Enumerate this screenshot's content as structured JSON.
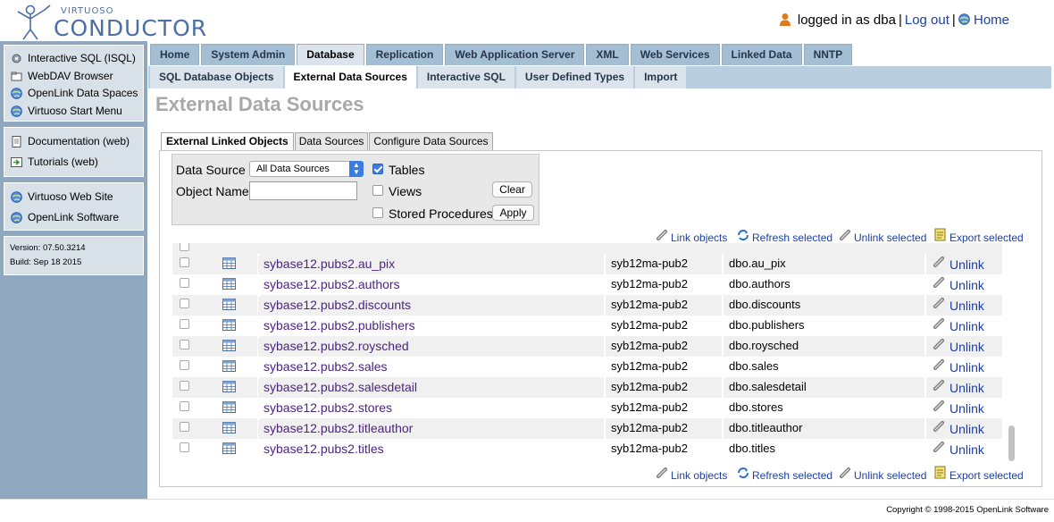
{
  "header": {
    "logo_small": "VIRTUOSO",
    "logo_big": "CONDUCTOR",
    "login_text": "logged in as dba",
    "logout": "Log out",
    "home": "Home"
  },
  "sidebar": {
    "group1": [
      {
        "label": "Interactive SQL (ISQL)",
        "icon": "gear-icon"
      },
      {
        "label": "WebDAV Browser",
        "icon": "folder-icon"
      },
      {
        "label": "OpenLink Data Spaces",
        "icon": "globe-icon"
      },
      {
        "label": "Virtuoso Start Menu",
        "icon": "globe-icon"
      }
    ],
    "group2": [
      {
        "label": "Documentation (web)",
        "icon": "document-icon"
      },
      {
        "label": "Tutorials (web)",
        "icon": "tutorial-icon"
      }
    ],
    "group3": [
      {
        "label": "Virtuoso Web Site",
        "icon": "globe-icon"
      },
      {
        "label": "OpenLink Software",
        "icon": "globe-icon"
      }
    ],
    "version": "Version: 07.50.3214",
    "build": "Build: Sep 18 2015"
  },
  "tabs": [
    "Home",
    "System Admin",
    "Database",
    "Replication",
    "Web Application Server",
    "XML",
    "Web Services",
    "Linked Data",
    "NNTP"
  ],
  "subtabs": [
    "SQL Database Objects",
    "External Data Sources",
    "Interactive SQL",
    "User Defined Types",
    "Import"
  ],
  "page_title": "External Data Sources",
  "inner_tabs": [
    "External Linked Objects",
    "Data Sources",
    "Configure Data Sources"
  ],
  "filter": {
    "data_source_label": "Data Source",
    "data_source_value": "All Data Sources",
    "object_name_label": "Object Name",
    "object_name_value": "",
    "tables_label": "Tables",
    "views_label": "Views",
    "procs_label": "Stored Procedures",
    "clear": "Clear",
    "apply": "Apply"
  },
  "actions": {
    "link": "Link objects",
    "refresh": "Refresh selected",
    "unlink": "Unlink selected",
    "export": "Export selected"
  },
  "rows": [
    {
      "name": "sybase12.pubs2.au_pix",
      "ds": "syb12ma-pub2",
      "remote": "dbo.au_pix",
      "action": "Unlink"
    },
    {
      "name": "sybase12.pubs2.authors",
      "ds": "syb12ma-pub2",
      "remote": "dbo.authors",
      "action": "Unlink"
    },
    {
      "name": "sybase12.pubs2.discounts",
      "ds": "syb12ma-pub2",
      "remote": "dbo.discounts",
      "action": "Unlink"
    },
    {
      "name": "sybase12.pubs2.publishers",
      "ds": "syb12ma-pub2",
      "remote": "dbo.publishers",
      "action": "Unlink"
    },
    {
      "name": "sybase12.pubs2.roysched",
      "ds": "syb12ma-pub2",
      "remote": "dbo.roysched",
      "action": "Unlink"
    },
    {
      "name": "sybase12.pubs2.sales",
      "ds": "syb12ma-pub2",
      "remote": "dbo.sales",
      "action": "Unlink"
    },
    {
      "name": "sybase12.pubs2.salesdetail",
      "ds": "syb12ma-pub2",
      "remote": "dbo.salesdetail",
      "action": "Unlink"
    },
    {
      "name": "sybase12.pubs2.stores",
      "ds": "syb12ma-pub2",
      "remote": "dbo.stores",
      "action": "Unlink"
    },
    {
      "name": "sybase12.pubs2.titleauthor",
      "ds": "syb12ma-pub2",
      "remote": "dbo.titleauthor",
      "action": "Unlink"
    },
    {
      "name": "sybase12.pubs2.titles",
      "ds": "syb12ma-pub2",
      "remote": "dbo.titles",
      "action": "Unlink"
    }
  ],
  "footer": "Copyright © 1998-2015 OpenLink Software"
}
